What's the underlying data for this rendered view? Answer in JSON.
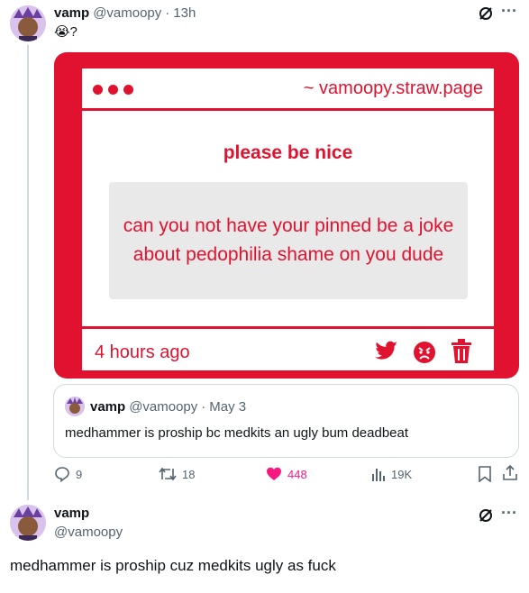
{
  "tweet1": {
    "display_name": "vamp",
    "handle": "@vamoopy",
    "dot": "·",
    "time": "13h",
    "text": "😭?"
  },
  "image": {
    "url": "~ vamoopy.straw.page",
    "prompt": "please be nice",
    "message": "can you not have your pinned be a joke about pedophilia shame on you dude",
    "time_ago": "4 hours ago"
  },
  "quote": {
    "display_name": "vamp",
    "handle": "@vamoopy",
    "dot": "·",
    "date": "May 3",
    "text": "medhammer is proship bc medkits an ugly bum deadbeat"
  },
  "actions": {
    "replies": "9",
    "retweets": "18",
    "likes": "448",
    "views": "19K"
  },
  "tweet2": {
    "display_name": "vamp",
    "handle": "@vamoopy",
    "text": "medhammer is proship cuz medkits ugly as fuck"
  },
  "more_label": "···",
  "colors": {
    "brand_red": "#e0122f",
    "like_pink": "#f91880",
    "muted": "#536471"
  },
  "icons": [
    "grok-icon",
    "more-icon",
    "reply-icon",
    "retweet-icon",
    "heart-icon",
    "views-icon",
    "bookmark-icon",
    "share-icon",
    "twitter-bird-icon",
    "angry-face-icon",
    "trash-icon"
  ]
}
